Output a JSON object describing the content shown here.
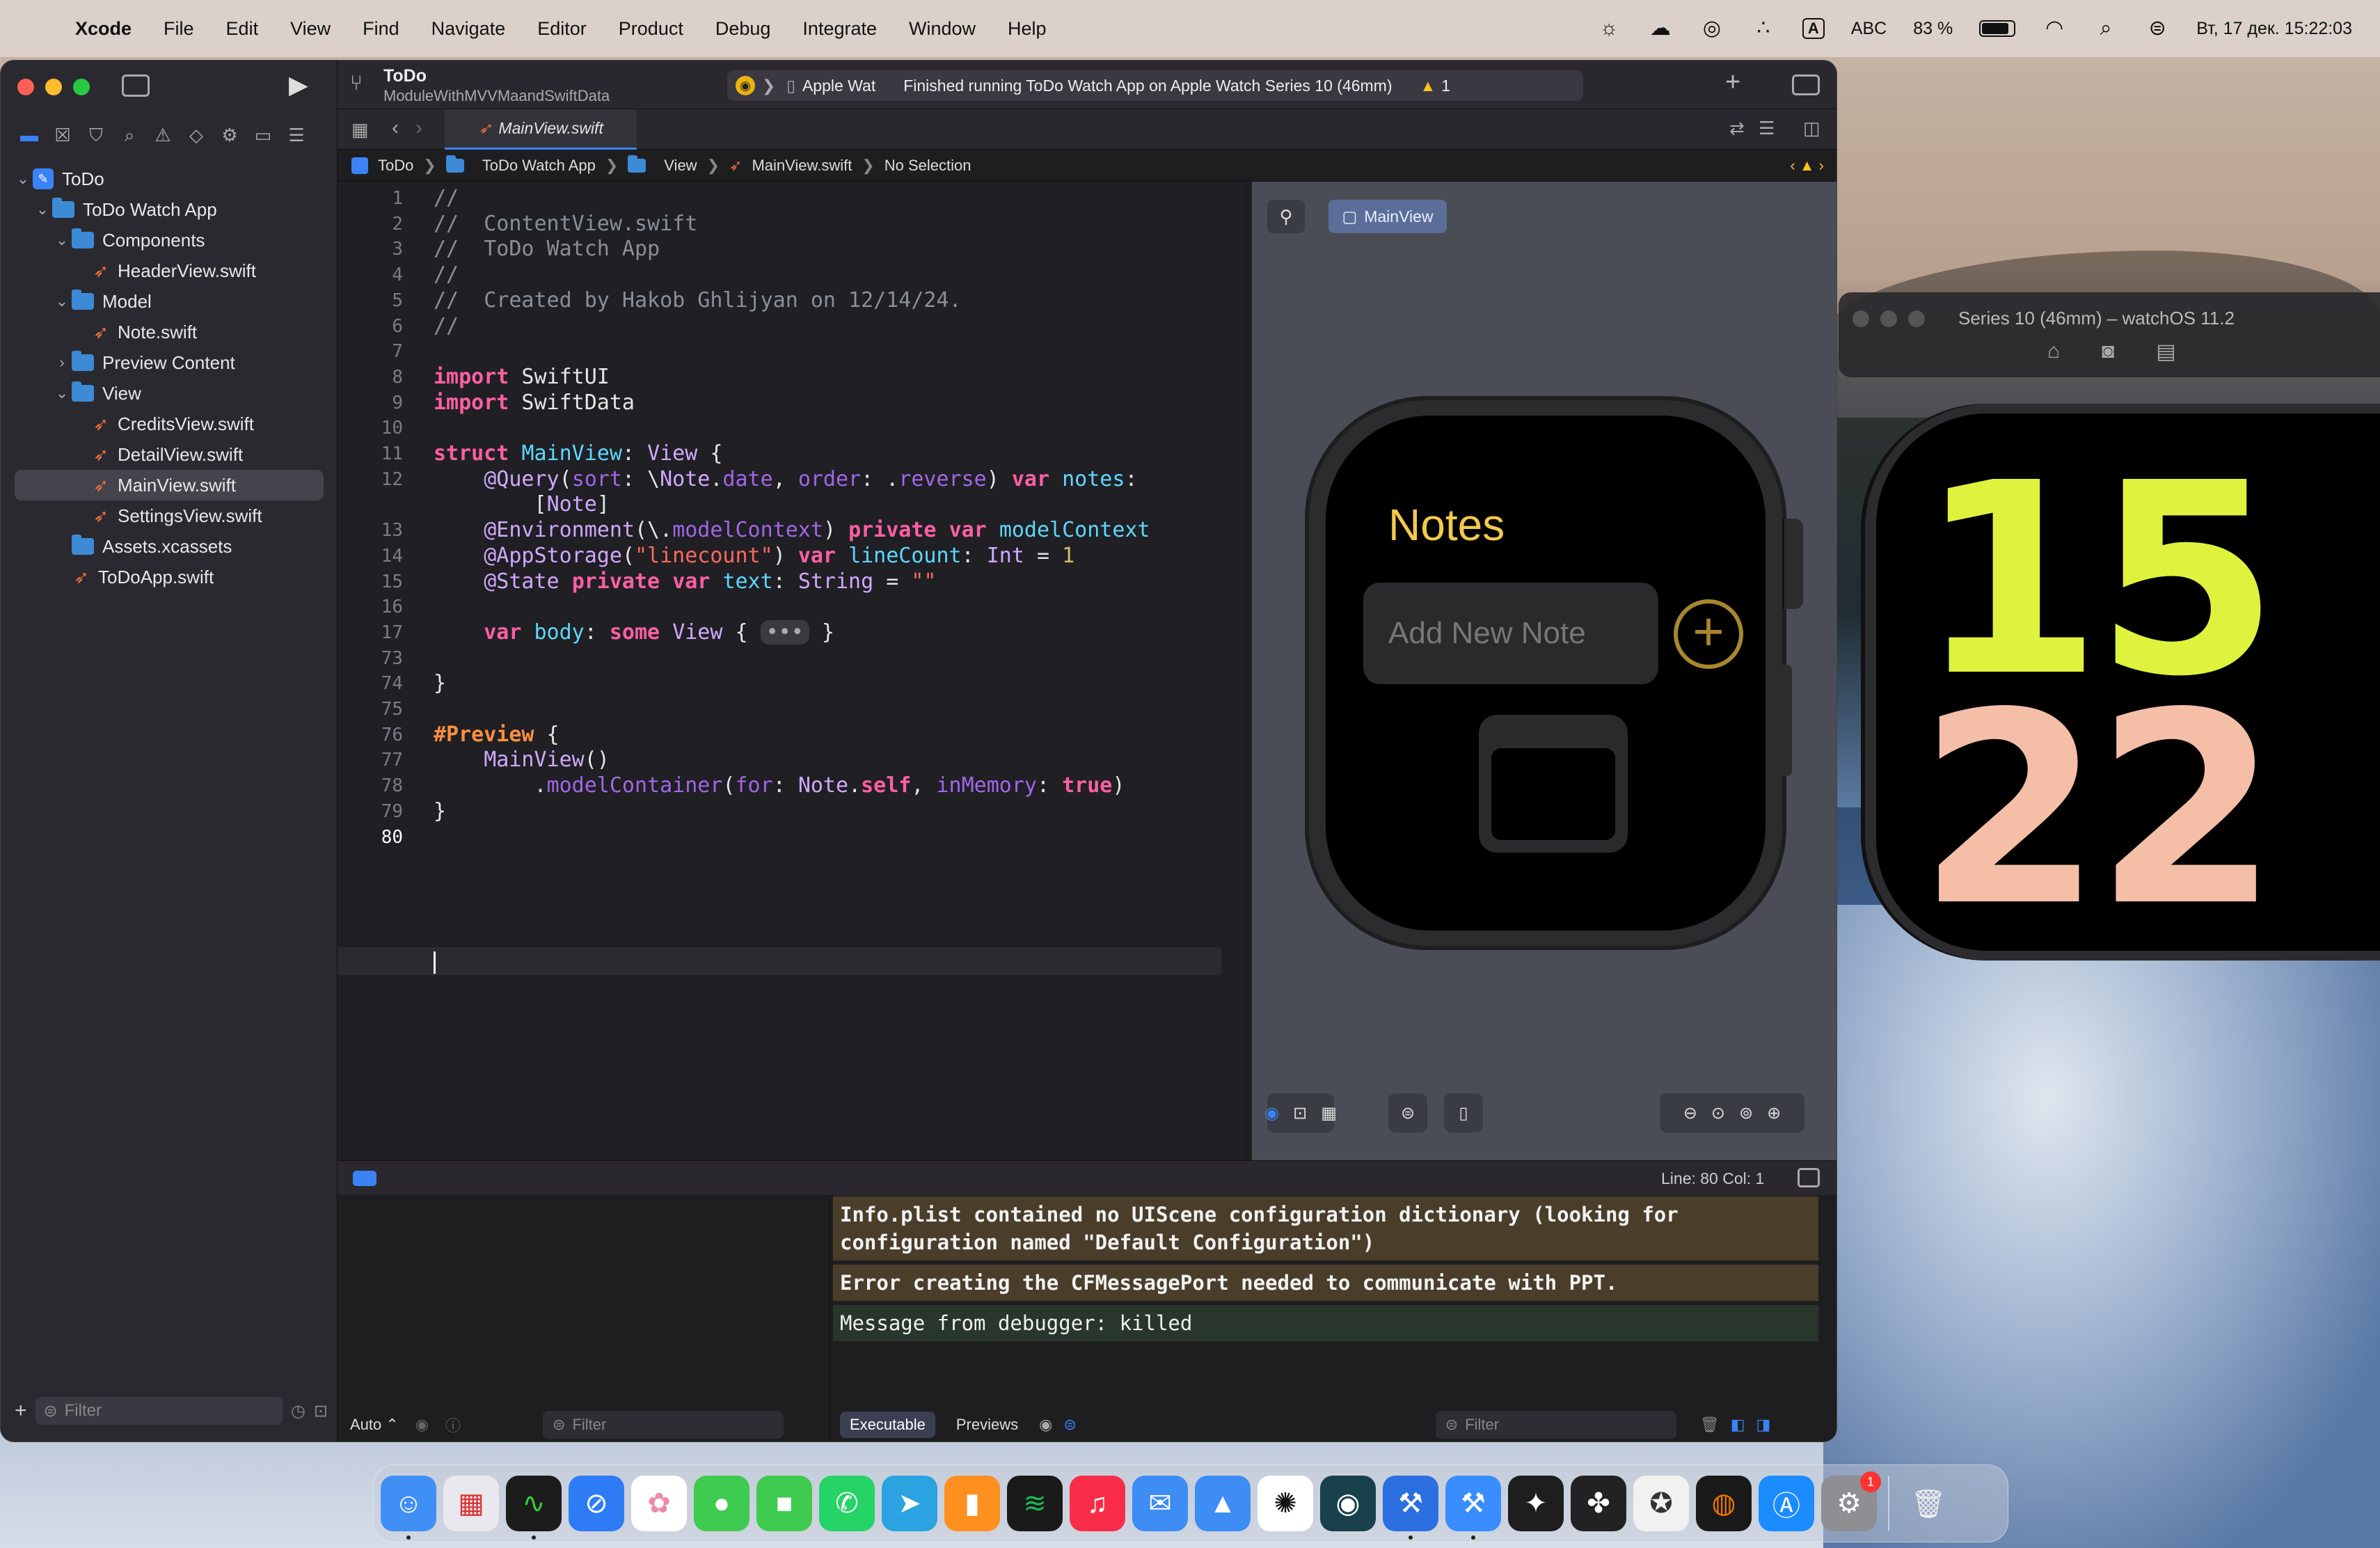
{
  "menubar": {
    "app": "Xcode",
    "items": [
      "File",
      "Edit",
      "View",
      "Find",
      "Navigate",
      "Editor",
      "Product",
      "Debug",
      "Integrate",
      "Window",
      "Help"
    ],
    "input_method": "ABC",
    "battery": "83 %",
    "datetime": "Вт, 17 дек.  15:22:03"
  },
  "toolbar": {
    "project": "ToDo",
    "subtitle": "ModuleWithMVVMaandSwiftData",
    "destination": "Apple Wat",
    "status": "Finished running ToDo Watch App on Apple Watch Series 10 (46mm)",
    "warnings": "1"
  },
  "navigator": {
    "tree": [
      {
        "label": "ToDo",
        "kind": "project",
        "depth": 0,
        "open": true
      },
      {
        "label": "ToDo Watch App",
        "kind": "folder",
        "depth": 1,
        "open": true
      },
      {
        "label": "Components",
        "kind": "folder",
        "depth": 2,
        "open": true
      },
      {
        "label": "HeaderView.swift",
        "kind": "swift",
        "depth": 3
      },
      {
        "label": "Model",
        "kind": "folder",
        "depth": 2,
        "open": true
      },
      {
        "label": "Note.swift",
        "kind": "swift",
        "depth": 3
      },
      {
        "label": "Preview Content",
        "kind": "folder",
        "depth": 2,
        "open": false
      },
      {
        "label": "View",
        "kind": "folder",
        "depth": 2,
        "open": true
      },
      {
        "label": "CreditsView.swift",
        "kind": "swift",
        "depth": 3
      },
      {
        "label": "DetailView.swift",
        "kind": "swift",
        "depth": 3
      },
      {
        "label": "MainView.swift",
        "kind": "swift",
        "depth": 3,
        "selected": true
      },
      {
        "label": "SettingsView.swift",
        "kind": "swift",
        "depth": 3
      },
      {
        "label": "Assets.xcassets",
        "kind": "assets",
        "depth": 2
      },
      {
        "label": "ToDoApp.swift",
        "kind": "swift",
        "depth": 2
      }
    ],
    "filter_placeholder": "Filter"
  },
  "tab": {
    "label": "MainView.swift"
  },
  "breadcrumb": [
    "ToDo",
    "ToDo Watch App",
    "View",
    "MainView.swift",
    "No Selection"
  ],
  "editor": {
    "lines": [
      {
        "n": "1",
        "html": "<span class='cmt'>//</span>"
      },
      {
        "n": "2",
        "html": "<span class='cmt'>//  ContentView.swift</span>"
      },
      {
        "n": "3",
        "html": "<span class='cmt'>//  ToDo Watch App</span>"
      },
      {
        "n": "4",
        "html": "<span class='cmt'>//</span>"
      },
      {
        "n": "5",
        "html": "<span class='cmt'>//  Created by Hakob Ghlijyan on 12/14/24.</span>"
      },
      {
        "n": "6",
        "html": "<span class='cmt'>//</span>"
      },
      {
        "n": "7",
        "html": ""
      },
      {
        "n": "8",
        "html": "<span class='kw'>import</span> SwiftUI"
      },
      {
        "n": "9",
        "html": "<span class='kw'>import</span> SwiftData"
      },
      {
        "n": "10",
        "html": ""
      },
      {
        "n": "11",
        "html": "<span class='kw'>struct</span> <span class='tb'>MainView</span>: <span class='ty'>View</span> {"
      },
      {
        "n": "12",
        "html": "    <span class='ty'>@Query</span>(<span class='id'>sort</span>: \\<span class='ty'>Note</span>.<span class='id'>date</span>, <span class='id'>order</span>: .<span class='id'>reverse</span>) <span class='kw'>var</span> <span class='tb'>notes</span>:"
      },
      {
        "n": "",
        "html": "        [<span class='ty'>Note</span>]"
      },
      {
        "n": "13",
        "html": "    <span class='ty'>@Environment</span>(\\.<span class='id'>modelContext</span>) <span class='kw'>private</span> <span class='kw'>var</span> <span class='tb'>modelContext</span>"
      },
      {
        "n": "14",
        "html": "    <span class='ty'>@AppStorage</span>(<span class='st'>\"linecount\"</span>) <span class='kw'>var</span> <span class='tb'>lineCount</span>: <span class='ty'>Int</span> = <span class='nm'>1</span>"
      },
      {
        "n": "15",
        "html": "    <span class='ty'>@State</span> <span class='kw'>private</span> <span class='kw'>var</span> <span class='tb'>text</span>: <span class='ty'>String</span> = <span class='st'>\"\"</span>"
      },
      {
        "n": "16",
        "html": ""
      },
      {
        "n": "17",
        "html": "    <span class='kw'>var</span> <span class='tb'>body</span>: <span class='kw'>some</span> <span class='ty'>View</span> { <span style='background:#3a3a42;border-radius:12px;padding:0 8px;color:#aaa'>•••</span> }"
      },
      {
        "n": "73",
        "html": ""
      },
      {
        "n": "74",
        "html": "}"
      },
      {
        "n": "75",
        "html": ""
      },
      {
        "n": "76",
        "html": "<span class='kw' style='color:#fd8f3f'>#Preview</span> {"
      },
      {
        "n": "77",
        "html": "    <span class='ty'>MainView</span>()"
      },
      {
        "n": "78",
        "html": "        .<span class='id'>modelContainer</span>(<span class='id'>for</span>: <span class='ty'>Note</span>.<span class='kw'>self</span>, <span class='id'>inMemory</span>: <span class='kw'>true</span>)"
      },
      {
        "n": "79",
        "html": "}"
      },
      {
        "n": "80",
        "html": ""
      }
    ]
  },
  "canvas": {
    "preview_label": "MainView",
    "watch_title": "Notes",
    "placeholder": "Add New Note"
  },
  "debug": {
    "position": "Line: 80  Col: 1",
    "messages": [
      {
        "kind": "warn",
        "text": "Info.plist contained no UIScene configuration dictionary (looking for\nconfiguration named \"Default Configuration\")"
      },
      {
        "kind": "warn",
        "text": "Error creating the CFMessagePort needed to communicate with PPT."
      },
      {
        "kind": "ok",
        "text": "Message from debugger: killed"
      }
    ],
    "auto_label": "Auto ⌃",
    "filter_placeholder": "Filter",
    "tabs": [
      "Executable",
      "Previews"
    ]
  },
  "simulator": {
    "title": "Series 10 (46mm) – watchOS 11.2",
    "hour": "15",
    "minute": "22",
    "hour_color": "#dff23d",
    "minute_color": "#f4bfa6"
  },
  "dock": {
    "apps": [
      {
        "name": "finder",
        "glyph": "☺",
        "bg": "#3f8ff5",
        "running": true
      },
      {
        "name": "launchpad",
        "glyph": "▦",
        "bg": "#e8e8ee",
        "fg": "#d33"
      },
      {
        "name": "activity-monitor",
        "glyph": "∿",
        "bg": "#1c1c1c",
        "fg": "#3c3",
        "running": true
      },
      {
        "name": "safari",
        "glyph": "⊘",
        "bg": "#2d7cf6"
      },
      {
        "name": "photos",
        "glyph": "✿",
        "bg": "#ffffff",
        "fg": "#e8a"
      },
      {
        "name": "messages",
        "glyph": "●",
        "bg": "#3fcb4f"
      },
      {
        "name": "facetime",
        "glyph": "■",
        "bg": "#3fcb4f"
      },
      {
        "name": "whatsapp",
        "glyph": "✆",
        "bg": "#25d366"
      },
      {
        "name": "telegram",
        "glyph": "➤",
        "bg": "#2aa3e0"
      },
      {
        "name": "books",
        "glyph": "▮",
        "bg": "#ff8f1f"
      },
      {
        "name": "spotify",
        "glyph": "≋",
        "bg": "#1a1a1a",
        "fg": "#1db954"
      },
      {
        "name": "music",
        "glyph": "♫",
        "bg": "#fa2d48"
      },
      {
        "name": "mail",
        "glyph": "✉",
        "bg": "#3d8df5"
      },
      {
        "name": "testflight",
        "glyph": "▲",
        "bg": "#3d8df5"
      },
      {
        "name": "chatgpt",
        "glyph": "✺",
        "bg": "#ffffff",
        "fg": "#111"
      },
      {
        "name": "gitkraken",
        "glyph": "◉",
        "bg": "#18414b"
      },
      {
        "name": "xcode",
        "glyph": "⚒",
        "bg": "#2b6fe0",
        "running": true
      },
      {
        "name": "instruments",
        "glyph": "⚒",
        "bg": "#3a8dff",
        "running": true
      },
      {
        "name": "figma",
        "glyph": "✦",
        "bg": "#1e1e1e"
      },
      {
        "name": "davinci",
        "glyph": "✤",
        "bg": "#222"
      },
      {
        "name": "sf-symbols",
        "glyph": "✪",
        "bg": "#f1f1f1",
        "fg": "#333"
      },
      {
        "name": "blender",
        "glyph": "◍",
        "bg": "#1a1a1a",
        "fg": "#ea7600"
      },
      {
        "name": "app-store",
        "glyph": "Ⓐ",
        "bg": "#1a8cff"
      },
      {
        "name": "system-settings",
        "glyph": "⚙",
        "bg": "#8e8e93",
        "badge": "1"
      },
      {
        "name": "trash",
        "glyph": "🗑",
        "bg": "transparent",
        "fg": "#eee"
      }
    ]
  }
}
